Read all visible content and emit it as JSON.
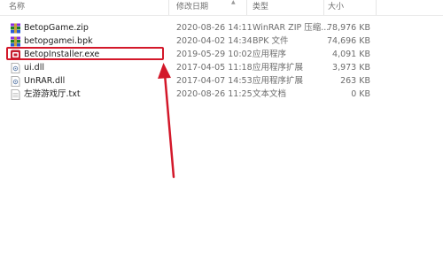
{
  "columns": {
    "name": "名称",
    "date": "修改日期",
    "type": "类型",
    "size": "大小"
  },
  "files": [
    {
      "name": "BetopGame.zip",
      "date": "2020-08-26 14:11",
      "type": "WinRAR ZIP 压缩...",
      "size": "78,976 KB",
      "icon": "winrar-zip-icon"
    },
    {
      "name": "betopgamei.bpk",
      "date": "2020-04-02 14:34",
      "type": "BPK 文件",
      "size": "74,696 KB",
      "icon": "winrar-archive-icon"
    },
    {
      "name": "BetopInstaller.exe",
      "date": "2019-05-29 10:02",
      "type": "应用程序",
      "size": "4,091 KB",
      "icon": "installer-app-icon"
    },
    {
      "name": "ui.dll",
      "date": "2017-04-05 11:18",
      "type": "应用程序扩展",
      "size": "3,973 KB",
      "icon": "dll-file-icon"
    },
    {
      "name": "UnRAR.dll",
      "date": "2017-04-07 14:53",
      "type": "应用程序扩展",
      "size": "263 KB",
      "icon": "dll-file-icon"
    },
    {
      "name": "左游游戏厅.txt",
      "date": "2020-08-26 11:25",
      "type": "文本文档",
      "size": "0 KB",
      "icon": "text-file-icon"
    }
  ],
  "annotation": {
    "highlighted_file": "BetopInstaller.exe",
    "highlight_color": "#d3182a",
    "arrow_color": "#d3182a"
  }
}
